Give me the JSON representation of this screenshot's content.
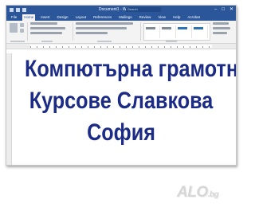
{
  "window": {
    "title": "Document1 - Word",
    "search_placeholder": "Search",
    "controls": [
      "–",
      "□",
      "✕"
    ]
  },
  "ribbon": {
    "tabs": [
      "File",
      "Home",
      "Insert",
      "Design",
      "Layout",
      "References",
      "Mailings",
      "Review",
      "View",
      "Help",
      "Acrobat"
    ],
    "active_tab": "Home"
  },
  "document": {
    "lines": [
      "Компютърна грамотност",
      "Курсове Славкова",
      "София"
    ],
    "text_color": "#1c2c86"
  },
  "watermark": {
    "brand": "ALO",
    "suffix": ".bg"
  },
  "colors": {
    "word_blue": "#2b579a",
    "ribbon_bg": "#f3f3f3"
  }
}
